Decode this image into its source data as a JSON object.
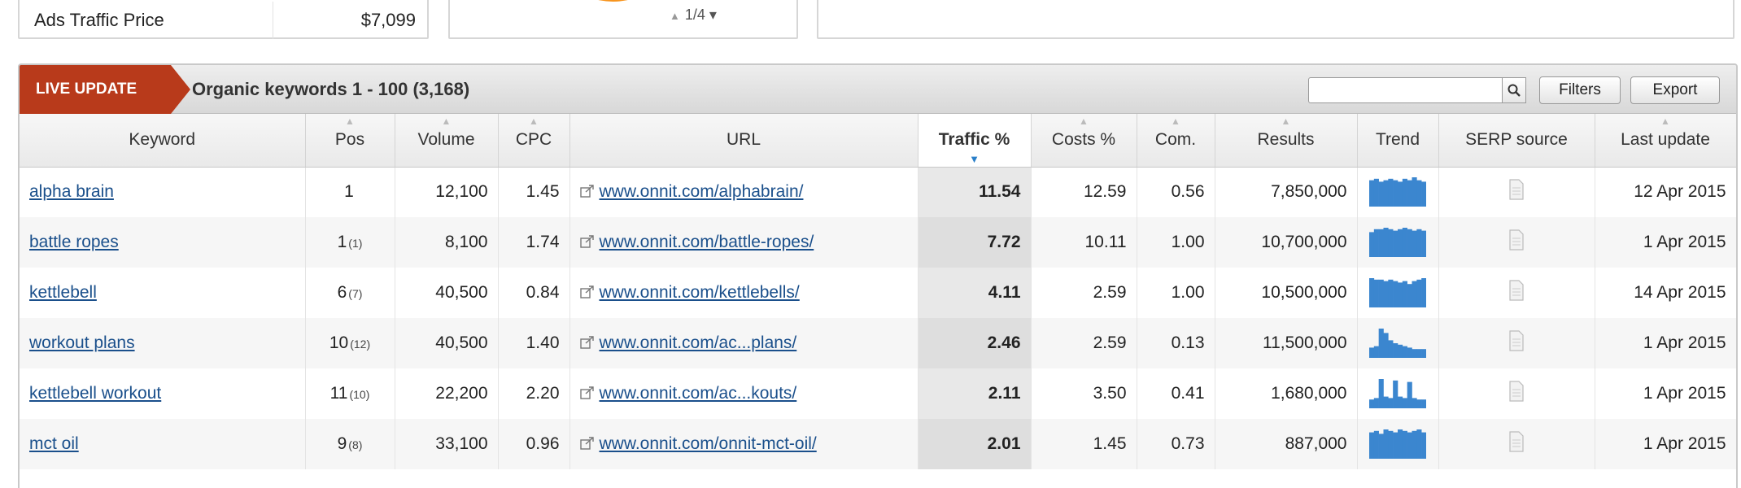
{
  "summary": {
    "ads_traffic_price_label": "Ads Traffic Price",
    "ads_traffic_price_value": "$7,099",
    "pager_text": "1/4 ▾"
  },
  "panel": {
    "live_badge": "LIVE UPDATE",
    "title": "Organic keywords 1 - 100 (3,168)",
    "search_placeholder": "",
    "filters_label": "Filters",
    "export_label": "Export"
  },
  "columns": {
    "keyword": "Keyword",
    "pos": "Pos",
    "volume": "Volume",
    "cpc": "CPC",
    "url": "URL",
    "traffic": "Traffic %",
    "costs": "Costs %",
    "com": "Com.",
    "results": "Results",
    "trend": "Trend",
    "serp": "SERP source",
    "last_update": "Last update"
  },
  "colors": {
    "accent_orange": "#f7941d",
    "live_badge": "#b83a1b",
    "link": "#1a4f8b",
    "trend_bars": "#3b86cf"
  },
  "rows": [
    {
      "keyword": "alpha brain",
      "pos": "1",
      "pos_prev": "",
      "volume": "12,100",
      "cpc": "1.45",
      "url": "www.onnit.com/alphabrain/",
      "traffic": "11.54",
      "costs": "12.59",
      "com": "0.56",
      "results": "7,850,000",
      "trend": [
        0.9,
        0.95,
        0.85,
        0.9,
        0.95,
        0.9,
        0.85,
        0.95,
        0.9,
        1.0,
        0.9,
        0.85
      ],
      "last_update": "12 Apr 2015"
    },
    {
      "keyword": "battle ropes",
      "pos": "1",
      "pos_prev": "(1)",
      "volume": "8,100",
      "cpc": "1.74",
      "url": "www.onnit.com/battle-ropes/",
      "traffic": "7.72",
      "costs": "10.11",
      "com": "1.00",
      "results": "10,700,000",
      "trend": [
        0.85,
        0.95,
        0.95,
        1.0,
        0.95,
        0.9,
        0.95,
        1.0,
        0.95,
        0.9,
        0.95,
        0.9
      ],
      "last_update": "1 Apr 2015"
    },
    {
      "keyword": "kettlebell",
      "pos": "6",
      "pos_prev": "(7)",
      "volume": "40,500",
      "cpc": "0.84",
      "url": "www.onnit.com/kettlebells/",
      "traffic": "4.11",
      "costs": "2.59",
      "com": "1.00",
      "results": "10,500,000",
      "trend": [
        1.0,
        0.95,
        0.95,
        0.9,
        0.95,
        0.9,
        0.85,
        0.9,
        0.8,
        0.9,
        0.95,
        1.0
      ],
      "last_update": "14 Apr 2015"
    },
    {
      "keyword": "workout plans",
      "pos": "10",
      "pos_prev": "(12)",
      "volume": "40,500",
      "cpc": "1.40",
      "url": "www.onnit.com/ac...plans/",
      "traffic": "2.46",
      "costs": "2.59",
      "com": "0.13",
      "results": "11,500,000",
      "trend": [
        0.35,
        0.4,
        1.0,
        0.85,
        0.6,
        0.5,
        0.45,
        0.4,
        0.35,
        0.3,
        0.3,
        0.3
      ],
      "last_update": "1 Apr 2015"
    },
    {
      "keyword": "kettlebell workout",
      "pos": "11",
      "pos_prev": "(10)",
      "volume": "22,200",
      "cpc": "2.20",
      "url": "www.onnit.com/ac...kouts/",
      "traffic": "2.11",
      "costs": "3.50",
      "com": "0.41",
      "results": "1,680,000",
      "trend": [
        0.3,
        0.35,
        1.0,
        0.4,
        0.35,
        0.95,
        0.4,
        0.35,
        0.9,
        0.35,
        0.3,
        0.3
      ],
      "last_update": "1 Apr 2015"
    },
    {
      "keyword": "mct oil",
      "pos": "9",
      "pos_prev": "(8)",
      "volume": "33,100",
      "cpc": "0.96",
      "url": "www.onnit.com/onnit-mct-oil/",
      "traffic": "2.01",
      "costs": "1.45",
      "com": "0.73",
      "results": "887,000",
      "trend": [
        0.9,
        0.95,
        0.85,
        1.0,
        0.95,
        0.9,
        1.0,
        0.95,
        0.9,
        0.95,
        1.0,
        0.9
      ],
      "last_update": "1 Apr 2015"
    }
  ]
}
